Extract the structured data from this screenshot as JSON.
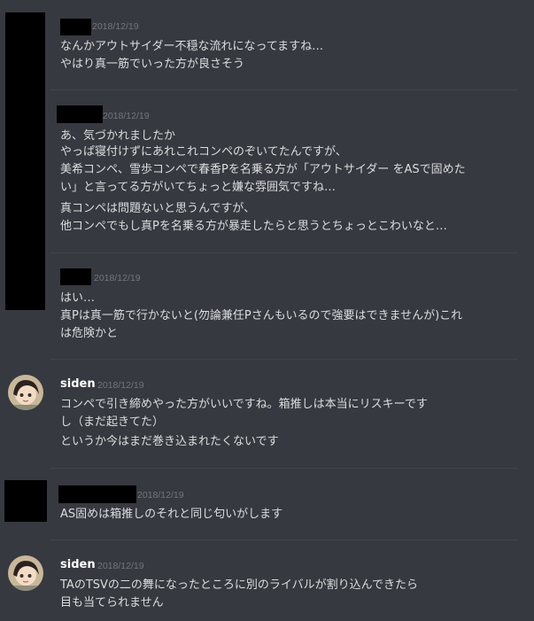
{
  "messages": [
    {
      "timestamp": "2018/12/19",
      "lines": [
        "なんかアウトサイダー不穏な流れになってますね…",
        "やはり真一筋でいった方が良さそう"
      ]
    },
    {
      "timestamp": "2018/12/19",
      "lines": [
        "あ、気づかれましたか",
        "やっぱ寝付けずにあれこれコンペのぞいてたんですが、",
        "美希コンペ、雪歩コンペで春香Pを名乗る方が「アウトサイダー をASで固めた",
        "い」と言ってる方がいてちょっと嫌な雰囲気ですね…",
        "真コンペは問題ないと思うんですが、",
        "他コンペでもし真Pを名乗る方が暴走したらと思うとちょっとこわいなと…"
      ]
    },
    {
      "timestamp": "2018/12/19",
      "lines": [
        "はい…",
        "真Pは真一筋で行かないと(勿論兼任Pさんもいるので強要はできませんが)これ",
        "は危険かと"
      ]
    },
    {
      "author": "siden",
      "timestamp": "2018/12/19",
      "lines": [
        "コンペで引き締めやった方がいいですね。箱推しは本当にリスキーです",
        "し（まだ起きてた）",
        "というか今はまだ巻き込まれたくないです"
      ]
    },
    {
      "timestamp": "2018/12/19",
      "lines": [
        "AS固めは箱推しのそれと同じ匂いがします"
      ]
    },
    {
      "author": "siden",
      "timestamp": "2018/12/19",
      "lines": [
        "TAのTSVの二の舞になったところに別のライバルが割り込んできたら",
        "目も当てられません"
      ]
    }
  ],
  "colors": {
    "background": "#36393f",
    "text": "#dcddde",
    "timestamp": "#72767d",
    "username": "#ffffff",
    "redaction": "#000000"
  }
}
